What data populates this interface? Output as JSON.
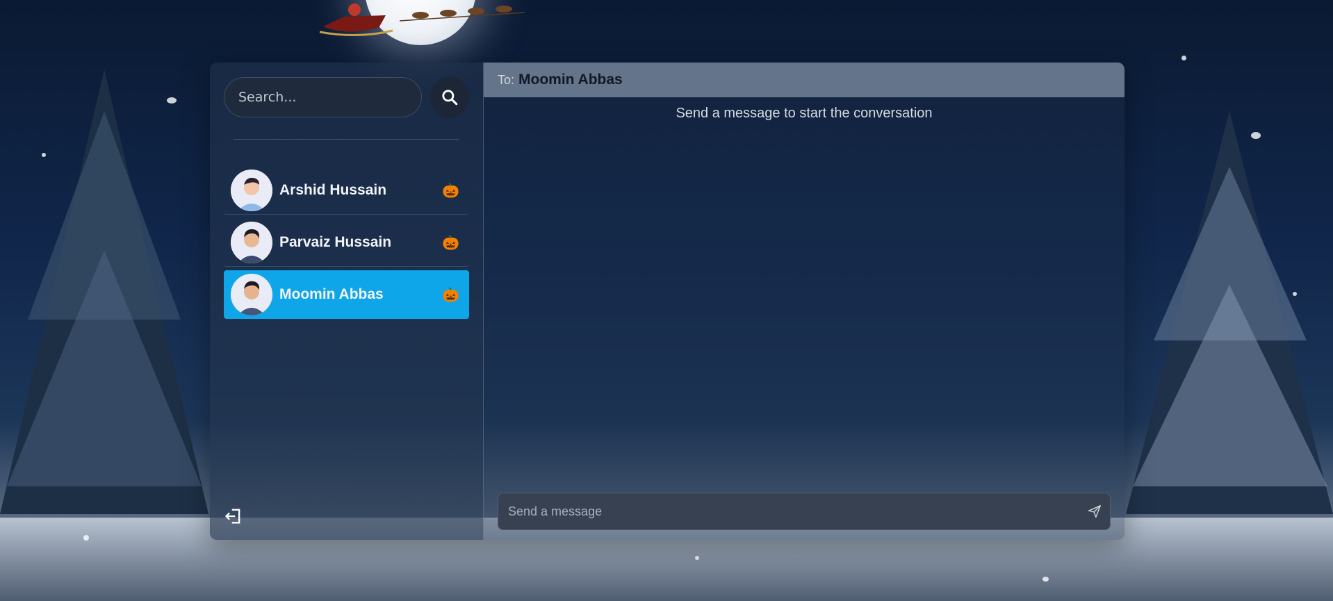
{
  "search": {
    "placeholder": "Search..."
  },
  "conversations": [
    {
      "name": "Arshid Hussain",
      "emoji": "🎃",
      "selected": false
    },
    {
      "name": "Parvaiz Hussain",
      "emoji": "🎃",
      "selected": false
    },
    {
      "name": "Moomin Abbas",
      "emoji": "🎃",
      "selected": true
    }
  ],
  "chat": {
    "to_label": "To:",
    "recipient": "Moomin Abbas",
    "empty_message": "Send a message to start the conversation",
    "composer_placeholder": "Send a message"
  },
  "icons": {
    "search": "search-icon",
    "logout": "logout-icon",
    "send": "send-icon"
  },
  "colors": {
    "selected": "#0ea5e9",
    "header": "#64748b",
    "composer": "#374151"
  }
}
